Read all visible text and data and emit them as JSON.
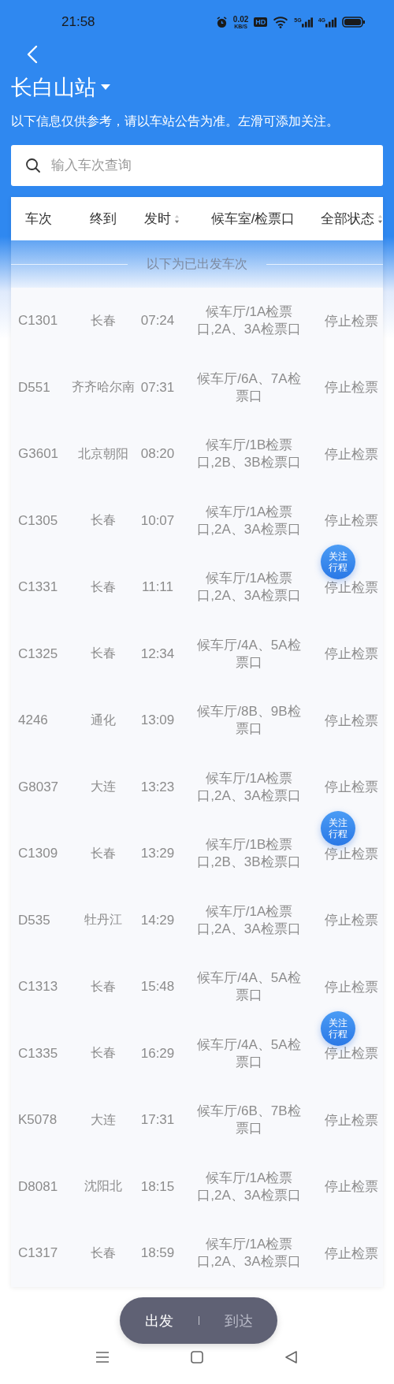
{
  "status_bar": {
    "time": "21:58",
    "net_speed": "0.02",
    "net_unit": "KB/S",
    "hd": "HD",
    "signal_1": "5G",
    "signal_2": "4G"
  },
  "station": {
    "title": "长白山站",
    "notice": "以下信息仅供参考，请以车站公告为准。左滑可添加关注。"
  },
  "search": {
    "placeholder": "输入车次查询"
  },
  "table": {
    "columns": [
      {
        "label": "车次",
        "sortable": false
      },
      {
        "label": "终到",
        "sortable": false
      },
      {
        "label": "发时",
        "sortable": true
      },
      {
        "label": "候车室/检票口",
        "sortable": false
      },
      {
        "label": "全部状态",
        "sortable": true
      }
    ],
    "divider": "以下为已出发车次",
    "rows": [
      {
        "train": "C1301",
        "destination": "长春",
        "departs": "07:24",
        "gate": "候车厅/1A检票口,2A、3A检票口",
        "status": "停止检票"
      },
      {
        "train": "D551",
        "destination": "齐齐哈尔南",
        "departs": "07:31",
        "gate": "候车厅/6A、7A检票口",
        "status": "停止检票"
      },
      {
        "train": "G3601",
        "destination": "北京朝阳",
        "departs": "08:20",
        "gate": "候车厅/1B检票口,2B、3B检票口",
        "status": "停止检票"
      },
      {
        "train": "C1305",
        "destination": "长春",
        "departs": "10:07",
        "gate": "候车厅/1A检票口,2A、3A检票口",
        "status": "停止检票"
      },
      {
        "train": "C1331",
        "destination": "长春",
        "departs": "11:11",
        "gate": "候车厅/1A检票口,2A、3A检票口",
        "status": "停止检票",
        "follow": "关注行程"
      },
      {
        "train": "C1325",
        "destination": "长春",
        "departs": "12:34",
        "gate": "候车厅/4A、5A检票口",
        "status": "停止检票"
      },
      {
        "train": "4246",
        "destination": "通化",
        "departs": "13:09",
        "gate": "候车厅/8B、9B检票口",
        "status": "停止检票"
      },
      {
        "train": "G8037",
        "destination": "大连",
        "departs": "13:23",
        "gate": "候车厅/1A检票口,2A、3A检票口",
        "status": "停止检票"
      },
      {
        "train": "C1309",
        "destination": "长春",
        "departs": "13:29",
        "gate": "候车厅/1B检票口,2B、3B检票口",
        "status": "停止检票",
        "follow": "关注行程"
      },
      {
        "train": "D535",
        "destination": "牡丹江",
        "departs": "14:29",
        "gate": "候车厅/1A检票口,2A、3A检票口",
        "status": "停止检票"
      },
      {
        "train": "C1313",
        "destination": "长春",
        "departs": "15:48",
        "gate": "候车厅/4A、5A检票口",
        "status": "停止检票"
      },
      {
        "train": "C1335",
        "destination": "长春",
        "departs": "16:29",
        "gate": "候车厅/4A、5A检票口",
        "status": "停止检票",
        "follow": "关注行程"
      },
      {
        "train": "K5078",
        "destination": "大连",
        "departs": "17:31",
        "gate": "候车厅/6B、7B检票口",
        "status": "停止检票"
      },
      {
        "train": "D8081",
        "destination": "沈阳北",
        "departs": "18:15",
        "gate": "候车厅/1A检票口,2A、3A检票口",
        "status": "停止检票"
      },
      {
        "train": "C1317",
        "destination": "长春",
        "departs": "18:59",
        "gate": "候车厅/1A检票口,2A、3A检票口",
        "status": "停止检票"
      }
    ]
  },
  "mode_switch": [
    {
      "label": "出发",
      "selected": true
    },
    {
      "label": "到达",
      "selected": false
    }
  ]
}
